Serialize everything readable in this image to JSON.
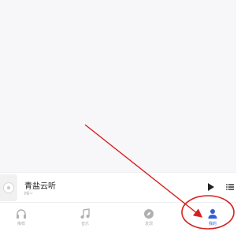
{
  "mini_player": {
    "title": "青盐云听",
    "subtitle": "Hi~"
  },
  "tabs": [
    {
      "label": "推荐",
      "icon": "headphones-icon"
    },
    {
      "label": "音乐",
      "icon": "music-note-icon"
    },
    {
      "label": "发现",
      "icon": "compass-icon"
    },
    {
      "label": "我的",
      "icon": "person-icon",
      "active": true
    }
  ],
  "colors": {
    "accent": "#2f5fd8",
    "annotation": "#d62020",
    "tab_inactive": "#b0b0b0"
  }
}
